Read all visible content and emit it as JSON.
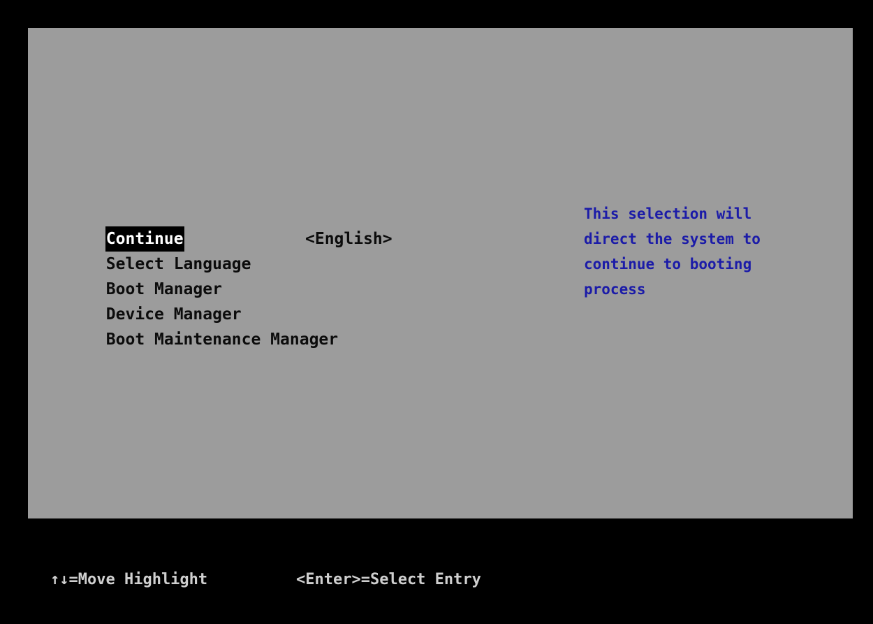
{
  "menu": {
    "items": [
      {
        "label": "Continue",
        "value": "",
        "selected": true
      },
      {
        "label": "Select Language",
        "value": "<English>",
        "selected": false
      },
      {
        "label": "Boot Manager",
        "value": "",
        "selected": false
      },
      {
        "label": "Device Manager",
        "value": "",
        "selected": false
      },
      {
        "label": "Boot Maintenance Manager",
        "value": "",
        "selected": false
      }
    ]
  },
  "help": {
    "lines": [
      "This selection will",
      "direct the system to",
      "continue to booting",
      "process"
    ]
  },
  "footer": {
    "move_hint": "↑↓=Move Highlight",
    "select_hint": "<Enter>=Select Entry"
  },
  "colors": {
    "panel_background": "#9c9c9c",
    "screen_background": "#000000",
    "help_text": "#1b1ba8",
    "highlight_background": "#000000",
    "highlight_text": "#ffffff"
  }
}
